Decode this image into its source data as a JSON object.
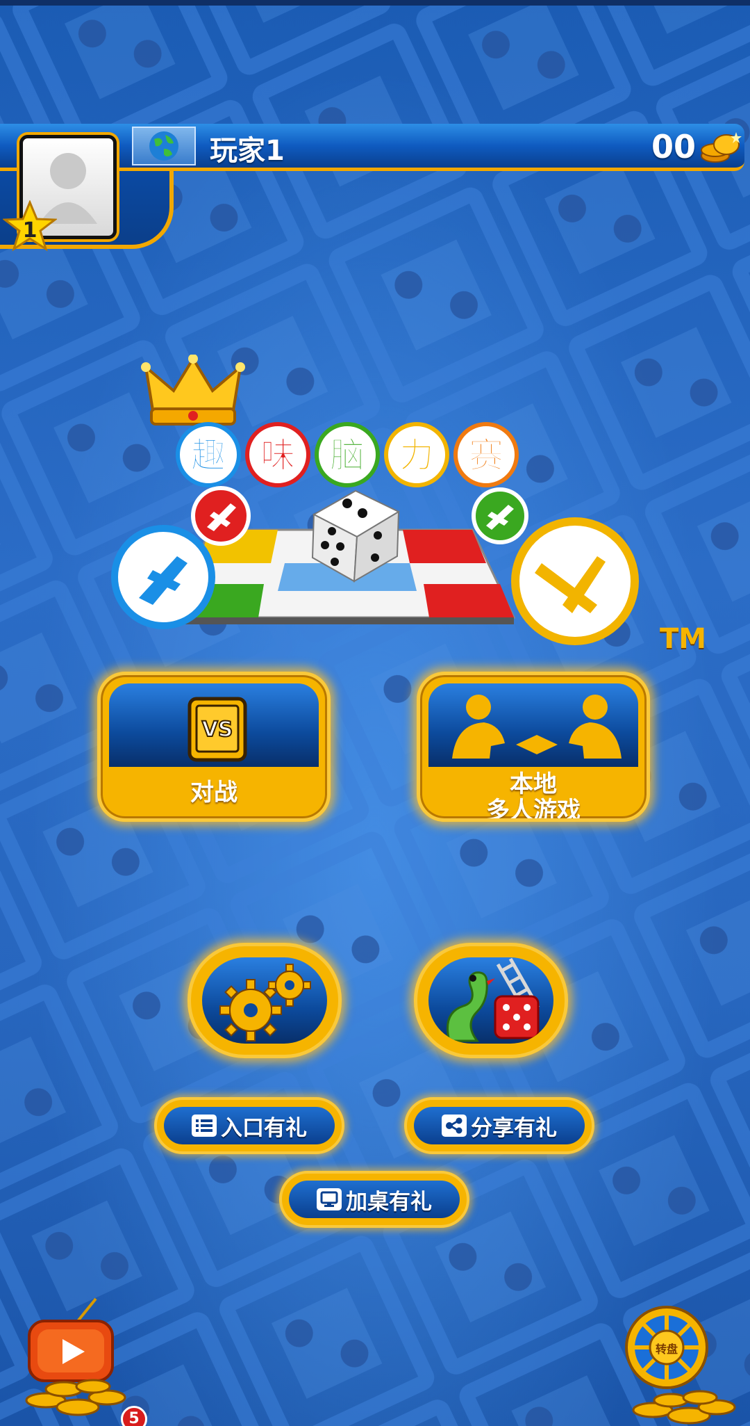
{
  "colors": {
    "background_blue": "#2766be",
    "accent_gold": "#f6b400",
    "header_blue": "#0f5bc0",
    "text_white": "#ffffff"
  },
  "header": {
    "player_name": "玩家1",
    "level": "1",
    "coins": "00",
    "globe_icon": "globe-icon",
    "coin_icon": "gold-coins-icon"
  },
  "logo": {
    "title_chars": [
      "趣",
      "味",
      "脑",
      "力",
      "赛"
    ],
    "title_colors": [
      "#1a8fe6",
      "#e02020",
      "#3aa820",
      "#f2b400",
      "#f07a10"
    ],
    "trademark": "TM"
  },
  "modes": {
    "battle": {
      "label": "对战",
      "icon": "vs-tablet-icon"
    },
    "local_multiplayer": {
      "label_line1": "本地",
      "label_line2": "多人游戏",
      "icon": "two-players-icon"
    }
  },
  "round_buttons": {
    "settings_icon": "gears-icon",
    "snakes_ladders_icon": "snake-ladder-dice-icon"
  },
  "pills": {
    "entry_gift": "入口有礼",
    "share_gift": "分享有礼",
    "desktop_gift": "加桌有礼"
  },
  "bottom": {
    "video_badge": "5",
    "wheel_label": "转盘"
  }
}
